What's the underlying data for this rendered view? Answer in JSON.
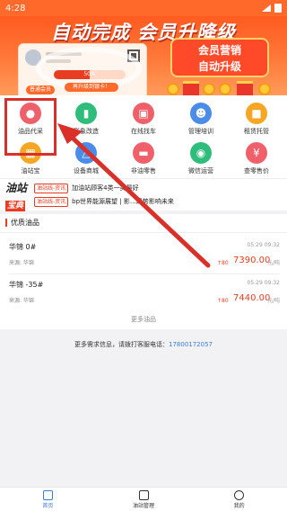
{
  "status_bar": {
    "time": "4:28"
  },
  "banner": {
    "title": "自动完成 会员升降级",
    "promo_line1": "会员营销",
    "promo_line2": "自动升级",
    "card_button": "普通会员",
    "progress_percent": 50,
    "progress_text": "50%",
    "progress_caption": "再升级到银卡！"
  },
  "icons": [
    {
      "label": "油品代采",
      "icon": "oil-drop-icon",
      "color": "#f0606a"
    },
    {
      "label": "形象改造",
      "icon": "gas-pump-icon",
      "color": "#2ebd7a"
    },
    {
      "label": "在线找车",
      "icon": "bus-icon",
      "color": "#f0606a"
    },
    {
      "label": "管理培训",
      "icon": "person-icon",
      "color": "#4a8ce8"
    },
    {
      "label": "租赁托管",
      "icon": "briefcase-icon",
      "color": "#f5a623"
    },
    {
      "label": "油站宝",
      "icon": "calculator-icon",
      "color": "#f5a623"
    },
    {
      "label": "设备商城",
      "icon": "cart-icon",
      "color": "#4a8ce8"
    },
    {
      "label": "非油零售",
      "icon": "wallet-icon",
      "color": "#f0606a"
    },
    {
      "label": "微信运营",
      "icon": "chat-icon",
      "color": "#2ebd7a"
    },
    {
      "label": "查零售价",
      "icon": "coin-icon",
      "color": "#f0606a"
    }
  ],
  "news": {
    "logo_line1": "油站",
    "logo_line2": "宝典",
    "items": [
      {
        "tag": "油站线-资讯",
        "text": "加油站顾客4类一类最好"
      },
      {
        "tag": "油站线-资讯",
        "text": "bp世界能源展望 | 影…趋势影响未来"
      }
    ]
  },
  "quality": {
    "title": "优质油品",
    "products": [
      {
        "name": "华锦 0#",
        "time": "05:29 09:32",
        "source": "来源: 华锦",
        "change": "↑80",
        "price": "7390.00",
        "unit": "元/吨"
      },
      {
        "name": "华锦 -35#",
        "time": "05:29 09:32",
        "source": "来源: 华锦",
        "change": "↑80",
        "price": "7440.00",
        "unit": "元/吨"
      }
    ],
    "more": "更多油品"
  },
  "contact": {
    "text": "更多需求信息，请拨打客服电话：",
    "phone": "17800172057"
  },
  "tabbar": [
    {
      "label": "首页",
      "icon": "home-icon",
      "active": true
    },
    {
      "label": "油站管理",
      "icon": "station-icon",
      "active": false
    },
    {
      "label": "我的",
      "icon": "user-icon",
      "active": false
    }
  ],
  "colors": {
    "brand": "#ff6a2a",
    "accent": "#e83d20",
    "link": "#3a7cd8"
  }
}
